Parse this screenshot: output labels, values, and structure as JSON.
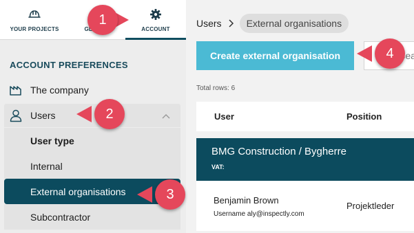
{
  "topnav": {
    "projects_label": "YOUR PROJECTS",
    "global_label": "GLOBAL",
    "account_label": "ACCOUNT"
  },
  "sidebar": {
    "section_title": "ACCOUNT PREFERENCES",
    "company_label": "The company",
    "users_label": "Users",
    "sub_items": [
      "User type",
      "Internal",
      "External organisations",
      "Subcontractor"
    ]
  },
  "breadcrumb": {
    "root": "Users",
    "current": "External organisations"
  },
  "toolbar": {
    "create_label": "Create external organisation",
    "search_placeholder": "Search"
  },
  "table": {
    "total_rows": "Total rows: 6",
    "columns": [
      "User",
      "Position"
    ],
    "organisation": {
      "name": "BMG Construction / Bygherre",
      "vat_label": "VAT:"
    },
    "people": [
      {
        "name": "Benjamin Brown",
        "username": "Username aly@inspectly.com",
        "position": "Projektleder"
      }
    ]
  },
  "callouts": [
    "1",
    "2",
    "3",
    "4"
  ],
  "colors": {
    "brand_dark": "#0c4b5e",
    "accent_button": "#4bbad4",
    "callout": "#e5475b"
  }
}
